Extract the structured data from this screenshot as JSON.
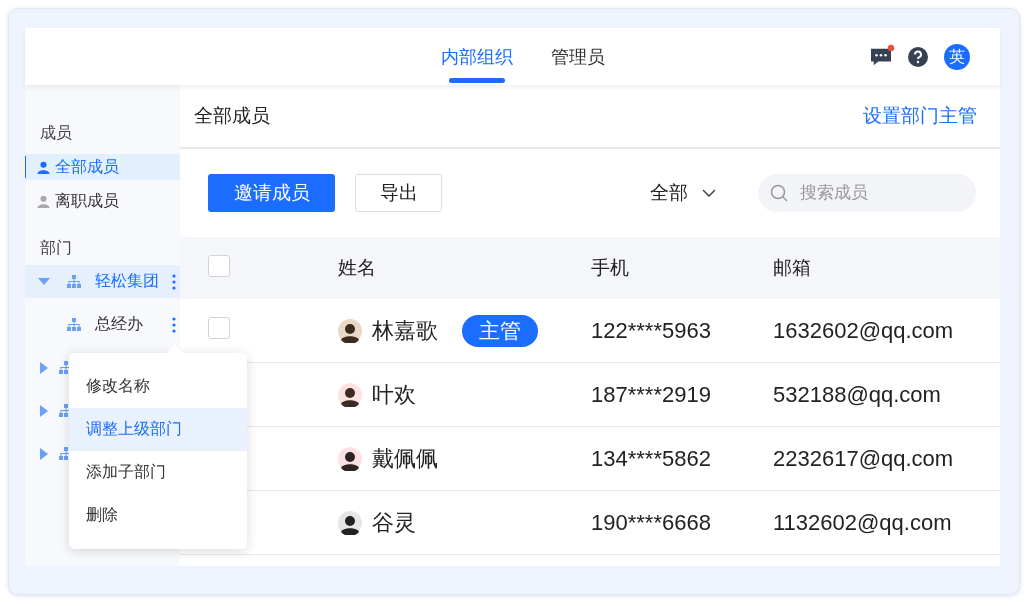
{
  "header": {
    "tabs": [
      {
        "label": "内部组织",
        "selected": true
      },
      {
        "label": "管理员",
        "selected": false
      }
    ],
    "notification": true,
    "avatar_text": "英"
  },
  "sidebar": {
    "members_title": "成员",
    "member_items": [
      {
        "label": "全部成员",
        "selected": true
      },
      {
        "label": "离职成员",
        "selected": false
      }
    ],
    "departments_title": "部门",
    "departments": [
      {
        "name": "轻松集团",
        "expanded": true,
        "selected": true,
        "children": [
          {
            "name": "总经办",
            "selected": false
          }
        ]
      },
      {
        "expanded": false,
        "selected": false
      },
      {
        "expanded": false,
        "selected": false
      },
      {
        "expanded": false,
        "selected": false
      }
    ]
  },
  "context_menu": {
    "items": [
      {
        "label": "修改名称",
        "selected": false
      },
      {
        "label": "调整上级部门",
        "selected": true
      },
      {
        "label": "添加子部门",
        "selected": false
      },
      {
        "label": "删除",
        "selected": false
      }
    ]
  },
  "main": {
    "title": "全部成员",
    "action_link": "设置部门主管",
    "invite_button": "邀请成员",
    "export_button": "导出",
    "filter": "全部",
    "search": {
      "placeholder": "搜索成员"
    },
    "table": {
      "header_checked": false,
      "columns": [
        "姓名",
        "手机",
        "邮箱"
      ],
      "rows": [
        {
          "name": "林嘉歌",
          "badge": "主管",
          "phone": "122****5963",
          "email": "1632602@qq.com",
          "checked": false
        },
        {
          "name": "叶欢",
          "phone": "187****2919",
          "email": "532188@qq.com"
        },
        {
          "name": "戴佩佩",
          "phone": "134****5862",
          "email": "2232617@qq.com"
        },
        {
          "name": "谷灵",
          "phone": "190****6668",
          "email": "1132602@qq.com"
        }
      ]
    }
  }
}
